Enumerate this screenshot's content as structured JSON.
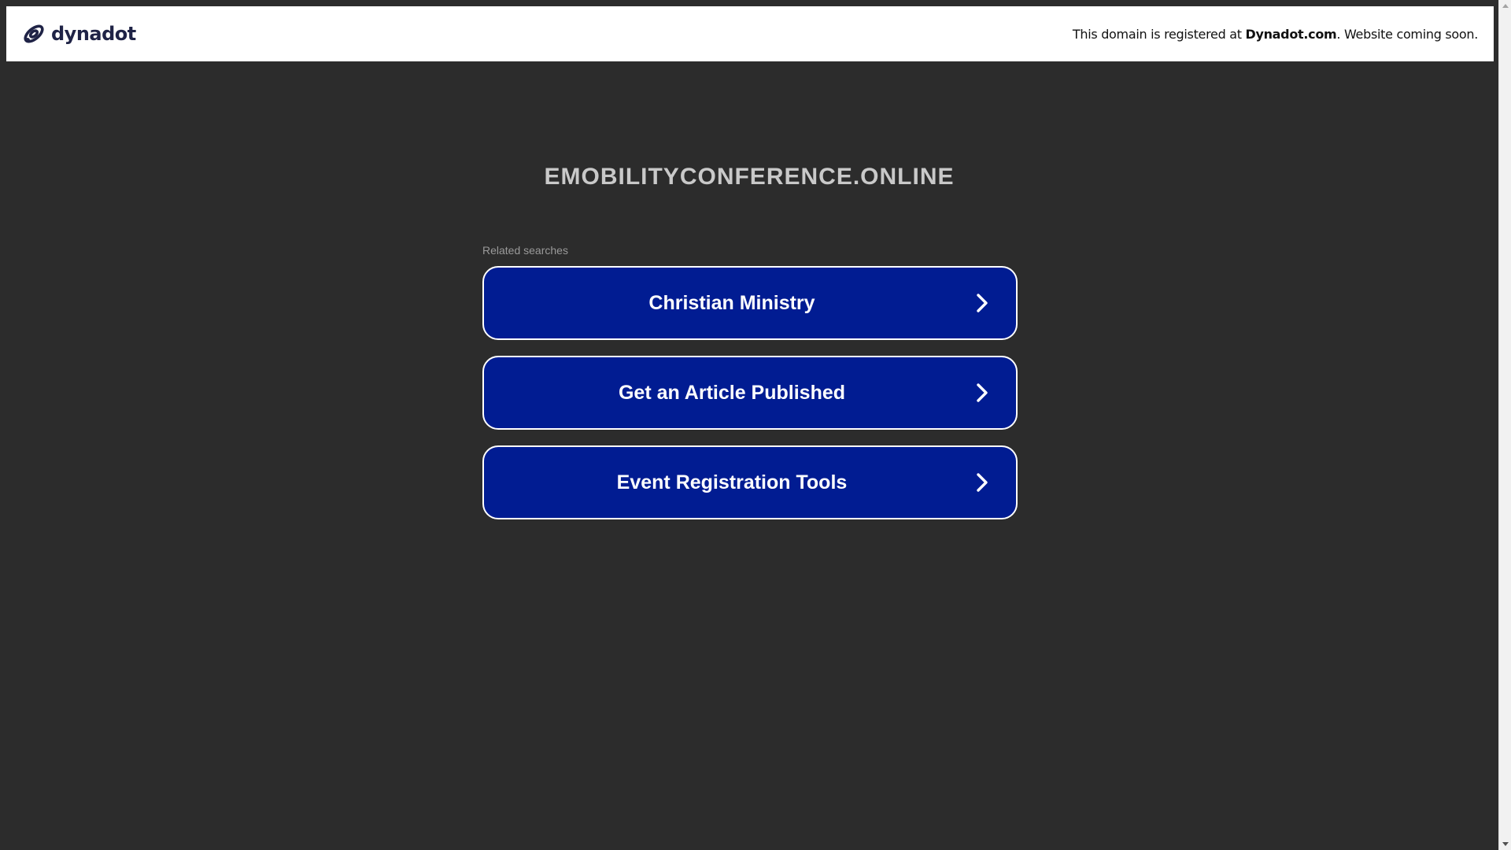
{
  "header": {
    "logo_text": "dynadot",
    "notice_prefix": "This domain is registered at ",
    "notice_brand": "Dynadot.com",
    "notice_suffix": ". Website coming soon."
  },
  "domain": "EMOBILITYCONFERENCE.ONLINE",
  "related_searches": {
    "label": "Related searches",
    "items": [
      {
        "label": "Christian Ministry"
      },
      {
        "label": "Get an Article Published"
      },
      {
        "label": "Event Registration Tools"
      }
    ]
  },
  "colors": {
    "page_background": "#2c2c2c",
    "button_fill": "#011c92",
    "button_border": "#ffffff",
    "logo_color": "#1f2346"
  },
  "icons": {
    "logo": "dynadot-logo-icon",
    "chevron": "chevron-right-icon"
  }
}
